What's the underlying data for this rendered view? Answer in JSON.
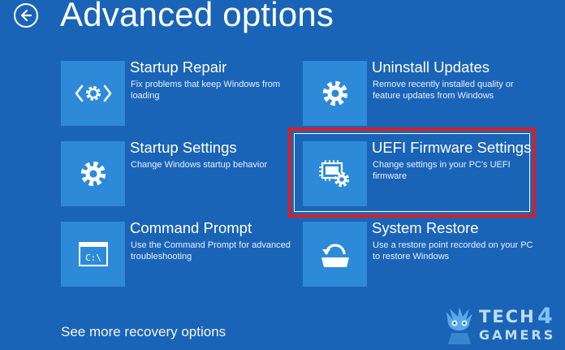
{
  "header": {
    "title": "Advanced options",
    "back_icon": "back-arrow-icon"
  },
  "options": [
    {
      "key": "startup-repair",
      "title": "Startup Repair",
      "description": "Fix problems that keep Windows from loading",
      "icon": "code-gear-icon"
    },
    {
      "key": "uninstall-updates",
      "title": "Uninstall Updates",
      "description": "Remove recently installed quality or feature updates from Windows",
      "icon": "gear-icon"
    },
    {
      "key": "startup-settings",
      "title": "Startup Settings",
      "description": "Change Windows startup behavior",
      "icon": "gear-icon"
    },
    {
      "key": "uefi-firmware-settings",
      "title": "UEFI Firmware Settings",
      "description": "Change settings in your PC's UEFI firmware",
      "icon": "chip-gear-icon",
      "highlighted": true
    },
    {
      "key": "command-prompt",
      "title": "Command Prompt",
      "description": "Use the Command Prompt for advanced troubleshooting",
      "icon": "terminal-icon",
      "icon_text": "C:\\"
    },
    {
      "key": "system-restore",
      "title": "System Restore",
      "description": "Use a restore point recorded on your PC to restore Windows",
      "icon": "restore-icon"
    }
  ],
  "footer": {
    "more_link": "See more recovery options"
  },
  "watermark": {
    "line1": "TECH",
    "digit": "4",
    "line2": "GAMERS"
  },
  "colors": {
    "background": "#1a64b8",
    "tile": "#2d8ad8",
    "highlight_border": "#d81f26",
    "text": "#ffffff"
  }
}
